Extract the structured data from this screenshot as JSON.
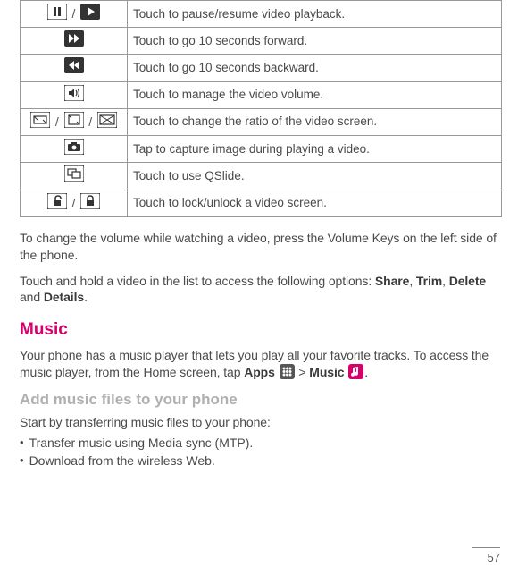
{
  "table": {
    "rows": [
      {
        "desc": "Touch to pause/resume video playback."
      },
      {
        "desc": "Touch to go 10 seconds forward."
      },
      {
        "desc": "Touch to go 10 seconds backward."
      },
      {
        "desc": "Touch to manage the video volume."
      },
      {
        "desc": "Touch to change the ratio of the video screen."
      },
      {
        "desc": "Tap to capture image during playing a video."
      },
      {
        "desc": "Touch to use QSlide."
      },
      {
        "desc": "Touch to lock/unlock a video screen."
      }
    ]
  },
  "para1": "To change the volume while watching a video, press the Volume Keys on the left side of the phone.",
  "para2_pre": "Touch and hold a video in the list to access the following options: ",
  "words": {
    "share": "Share",
    "trim": "Trim",
    "delete": "Delete",
    "and_sp": " and ",
    "details": "Details",
    "comma": ", ",
    "period": "."
  },
  "music_heading": "Music",
  "music_para_pre": "Your phone has a music player that lets you play all your favorite tracks. To access the music player, from the Home screen, tap ",
  "apps_label": "Apps",
  "gt": " > ",
  "music_label": "Music",
  "sub_heading": "Add music files to your phone",
  "sub_para": "Start by transferring music files to your phone:",
  "bullets": [
    "Transfer music using Media sync (MTP).",
    "Download from the wireless Web."
  ],
  "page_number": "57"
}
